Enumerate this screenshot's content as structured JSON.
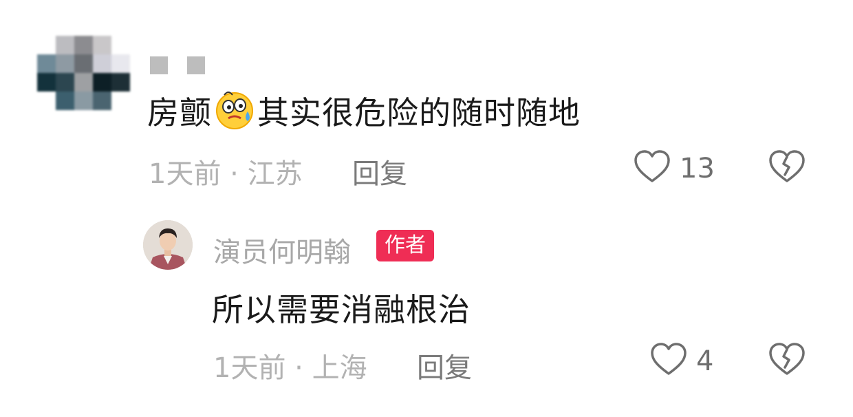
{
  "comment": {
    "text_before_emoji": "房颤",
    "emoji": "sweating-face-emoji",
    "text_after_emoji": "其实很危险的随时随地",
    "meta": "1天前 · 江苏",
    "reply_label": "回复",
    "like_count": "13"
  },
  "reply": {
    "username": "演员何明翰",
    "badge": "作者",
    "text": "所以需要消融根治",
    "meta": "1天前 · 上海",
    "reply_label": "回复",
    "like_count": "4"
  },
  "colors": {
    "badge_bg": "#ef2d55",
    "text_primary": "#1a1a1a",
    "text_secondary": "#b2b2b2"
  }
}
